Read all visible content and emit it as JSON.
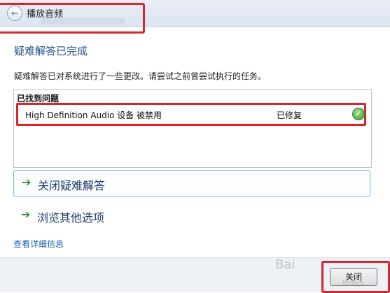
{
  "window": {
    "title": "播放音频"
  },
  "main": {
    "heading": "疑难解答已完成",
    "description": "疑难解答已对系统进行了一些更改。请尝试之前曾尝试执行的任务。",
    "results_header": "已找到问题",
    "issues": [
      {
        "name": "High Definition Audio 设备 被禁用",
        "status": "已修复"
      }
    ],
    "actions": [
      {
        "label": "关闭疑难解答"
      },
      {
        "label": "浏览其他选项"
      }
    ],
    "details_link": "查看详细信息"
  },
  "footer": {
    "close_label": "关闭"
  },
  "watermark": {
    "text": "Bai",
    "subtext": "lenovo"
  },
  "colors": {
    "accent_red": "#d9262e",
    "heading_blue": "#1e4f8f",
    "link_blue": "#1a5fb4",
    "arrow_green": "#2b9a2b"
  }
}
